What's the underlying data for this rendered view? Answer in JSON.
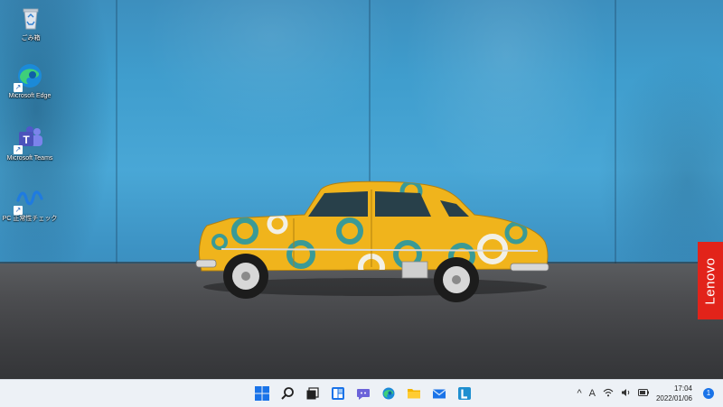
{
  "desktop": {
    "icons": [
      {
        "label": "ごみ箱",
        "icon": "recycle-bin-icon"
      },
      {
        "label": "Microsoft Edge",
        "icon": "edge-icon"
      },
      {
        "label": "Microsoft Teams",
        "icon": "teams-icon"
      },
      {
        "label": "PC 正常性チェック",
        "icon": "pc-health-check-icon"
      }
    ],
    "brand_tab": "Lenovo"
  },
  "taskbar": {
    "apps": [
      {
        "name": "start",
        "icon": "windows-start-icon"
      },
      {
        "name": "search",
        "icon": "search-icon"
      },
      {
        "name": "task-view",
        "icon": "task-view-icon"
      },
      {
        "name": "widgets",
        "icon": "widgets-icon"
      },
      {
        "name": "chat",
        "icon": "teams-chat-icon"
      },
      {
        "name": "edge",
        "icon": "edge-icon"
      },
      {
        "name": "file-explorer",
        "icon": "folder-icon"
      },
      {
        "name": "mail",
        "icon": "mail-icon"
      },
      {
        "name": "lenovo-app",
        "icon": "lenovo-l-icon"
      }
    ],
    "tray": {
      "chevron": "^",
      "ime": "A",
      "time": "17:04",
      "date": "2022/01/06",
      "notification_count": "1"
    }
  },
  "colors": {
    "taskbar_bg": "#edf1f6",
    "accent": "#1a73e8",
    "lenovo_red": "#e2231a",
    "car_yellow": "#f0b41c",
    "car_ring": "#3a9a96"
  }
}
